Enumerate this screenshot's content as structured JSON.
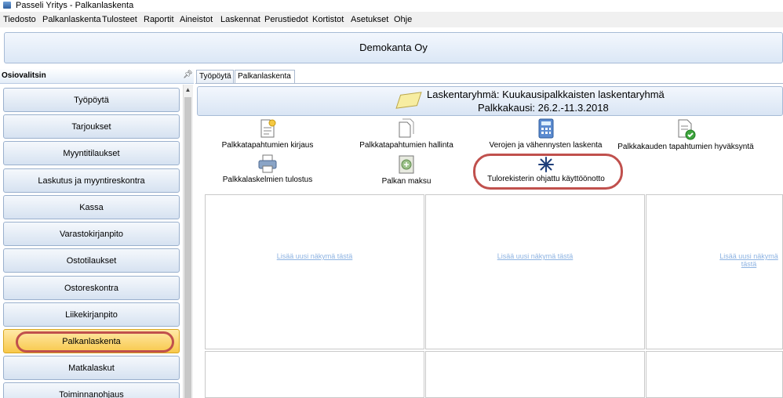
{
  "window": {
    "title": "Passeli Yritys - Palkanlaskenta"
  },
  "menu": [
    "Tiedosto",
    "Palkanlaskenta",
    "Tulosteet",
    "Raportit",
    "Aineistot",
    "Laskennat",
    "Perustiedot",
    "Kortistot",
    "Asetukset",
    "Ohje"
  ],
  "company": "Demokanta Oy",
  "sidebar": {
    "header": "Osiovalitsin",
    "items": [
      "Työpöytä",
      "Tarjoukset",
      "Myyntitilaukset",
      "Laskutus ja myyntireskontra",
      "Kassa",
      "Varastokirjanpito",
      "Ostotilaukset",
      "Ostoreskontra",
      "Liikekirjanpito",
      "Palkanlaskenta",
      "Matkalaskut",
      "Toiminnanohjaus"
    ],
    "active_item": "Palkanlaskenta"
  },
  "tabs": [
    "Työpöytä",
    "Palkanlaskenta"
  ],
  "active_tab": "Palkanlaskenta",
  "group": {
    "line1": "Laskentaryhmä: Kuukausipalkkaisten laskentaryhmä",
    "line2": "Palkkakausi: 26.2.-11.3.2018"
  },
  "actions": [
    {
      "label": "Palkkatapahtumien kirjaus",
      "icon": "document-star-icon"
    },
    {
      "label": "Palkkatapahtumien hallinta",
      "icon": "documents-icon"
    },
    {
      "label": "Verojen ja vähennysten laskenta",
      "icon": "calculator-icon"
    },
    {
      "label": "Palkkakauden tapahtumien hyväksyntä",
      "icon": "document-check-icon"
    },
    {
      "label": "Palkkalaskelmien tulostus",
      "icon": "printer-icon"
    },
    {
      "label": "Palkan maksu",
      "icon": "payment-icon"
    },
    {
      "label": "Tulorekisterin ohjattu käyttöönotto",
      "icon": "asterisk-icon"
    }
  ],
  "panels": {
    "add_view_link": "Lisää uusi näkymä tästä"
  },
  "colors": {
    "highlight": "#c0504d",
    "active_item": "#f8c84a",
    "link": "#8db3e2"
  }
}
